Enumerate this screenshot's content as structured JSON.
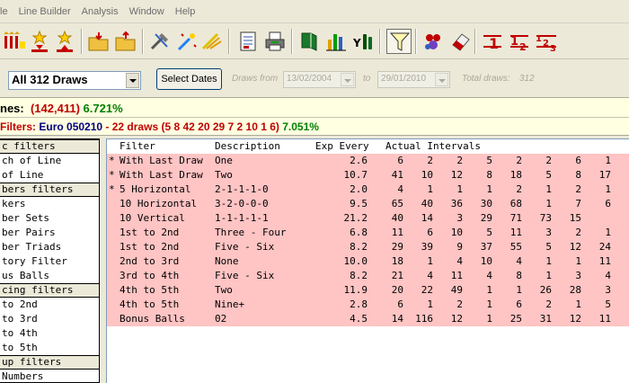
{
  "menu": [
    "le",
    "Line Builder",
    "Analysis",
    "Window",
    "Help"
  ],
  "draws_select": {
    "value": "All 312 Draws"
  },
  "select_dates_label": "Select Dates",
  "draws_from": {
    "label": "Draws from",
    "value": "13/02/2004"
  },
  "draws_to": {
    "label": "to",
    "value": "29/01/2010"
  },
  "total_draws": {
    "label": "Total draws:",
    "value": "312"
  },
  "status1": {
    "prefix": "nes:",
    "combos": "(142,411)",
    "percent": "6.721%"
  },
  "status2": {
    "prefix": "Filters:",
    "name": "Euro 050210",
    "detail": "- 22 draws (5 8 42 20 29 7 2 10 1 6)",
    "percent": "7.051%"
  },
  "left_panel": [
    {
      "text": "c filters",
      "header": true
    },
    {
      "text": "ch of Line",
      "header": false
    },
    {
      "text": " of Line",
      "header": false
    },
    {
      "text": "bers filters",
      "header": true
    },
    {
      "text": "kers",
      "header": false
    },
    {
      "text": "ber Sets",
      "header": false
    },
    {
      "text": "ber Pairs",
      "header": false
    },
    {
      "text": "ber Triads",
      "header": false
    },
    {
      "text": "tory Filter",
      "header": false
    },
    {
      "text": "us Balls",
      "header": false
    },
    {
      "text": "cing filters",
      "header": true
    },
    {
      "text": " to 2nd",
      "header": false
    },
    {
      "text": " to 3rd",
      "header": false
    },
    {
      "text": " to 4th",
      "header": false
    },
    {
      "text": " to 5th",
      "header": false
    },
    {
      "text": "up filters",
      "header": true
    },
    {
      "text": " Numbers",
      "header": false
    }
  ],
  "grid": {
    "headers": {
      "filter": "Filter",
      "description": "Description",
      "exp_every": "Exp Every",
      "actual_intervals": "Actual Intervals"
    },
    "rows": [
      {
        "mark": "*",
        "filter": "With Last Draw",
        "description": "One",
        "exp": "2.6",
        "intervals": [
          "6",
          "2",
          "2",
          "5",
          "2",
          "2",
          "6",
          "1"
        ]
      },
      {
        "mark": "*",
        "filter": "With Last Draw",
        "description": "Two",
        "exp": "10.7",
        "intervals": [
          "41",
          "10",
          "12",
          "8",
          "18",
          "5",
          "8",
          "17"
        ]
      },
      {
        "mark": "*",
        "filter": "5 Horizontal",
        "description": "2-1-1-1-0",
        "exp": "2.0",
        "intervals": [
          "4",
          "1",
          "1",
          "1",
          "2",
          "1",
          "2",
          "1"
        ]
      },
      {
        "mark": "",
        "filter": "10 Horizontal",
        "description": "3-2-0-0-0",
        "exp": "9.5",
        "intervals": [
          "65",
          "40",
          "36",
          "30",
          "68",
          "1",
          "7",
          "6"
        ]
      },
      {
        "mark": "",
        "filter": "10 Vertical",
        "description": "1-1-1-1-1",
        "exp": "21.2",
        "intervals": [
          "40",
          "14",
          "3",
          "29",
          "71",
          "73",
          "15",
          ""
        ]
      },
      {
        "mark": "",
        "filter": "1st to 2nd",
        "description": "Three - Four",
        "exp": "6.8",
        "intervals": [
          "11",
          "6",
          "10",
          "5",
          "11",
          "3",
          "2",
          "1"
        ]
      },
      {
        "mark": "",
        "filter": "1st to 2nd",
        "description": "Five - Six",
        "exp": "8.2",
        "intervals": [
          "29",
          "39",
          "9",
          "37",
          "55",
          "5",
          "12",
          "24"
        ]
      },
      {
        "mark": "",
        "filter": "2nd to 3rd",
        "description": "None",
        "exp": "10.0",
        "intervals": [
          "18",
          "1",
          "4",
          "10",
          "4",
          "1",
          "1",
          "11"
        ]
      },
      {
        "mark": "",
        "filter": "3rd to 4th",
        "description": "Five - Six",
        "exp": "8.2",
        "intervals": [
          "21",
          "4",
          "11",
          "4",
          "8",
          "1",
          "3",
          "4"
        ]
      },
      {
        "mark": "",
        "filter": "4th to 5th",
        "description": "Two",
        "exp": "11.9",
        "intervals": [
          "20",
          "22",
          "49",
          "1",
          "1",
          "26",
          "28",
          "3"
        ]
      },
      {
        "mark": "",
        "filter": "4th to 5th",
        "description": "Nine+",
        "exp": "2.8",
        "intervals": [
          "6",
          "1",
          "2",
          "1",
          "6",
          "2",
          "1",
          "5"
        ]
      },
      {
        "mark": "",
        "filter": "Bonus Balls",
        "description": "02",
        "exp": "4.5",
        "intervals": [
          "14",
          "116",
          "12",
          "1",
          "25",
          "31",
          "12",
          "11"
        ]
      }
    ]
  }
}
